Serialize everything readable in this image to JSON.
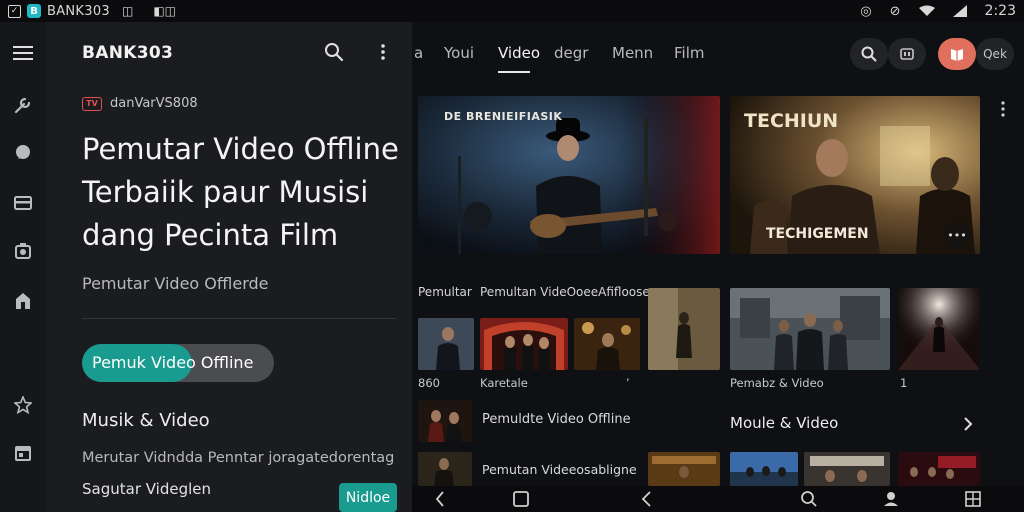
{
  "status_bar": {
    "carrier": "BANK303",
    "time": "2:23"
  },
  "drawer": {
    "app_title": "BANK303",
    "source_label": "danVarVS808",
    "source_logo": "TV",
    "headline": "Pemutar Video Offline Terbaiik paur Musisi dang Pecinta Film",
    "subline": "Pemutar Video Offlerde",
    "pill_label": "Pemuk Video Offline",
    "section_title": "Musik & Video",
    "description_1": "Merutar Vidndda  Penntar joragatedorentag",
    "description_2": "Sagutar Videglen",
    "small_button": "Nidloe"
  },
  "tabs": {
    "items": [
      {
        "label": "a"
      },
      {
        "label": "Youi"
      },
      {
        "label": "Video"
      },
      {
        "label": "degr"
      },
      {
        "label": "Menn"
      },
      {
        "label": "Film"
      }
    ],
    "toolbar_text_button": "Qek"
  },
  "hero": {
    "left_text": "DE  BRENIEIFIASIK",
    "right_title": "TECHIUN",
    "right_caption": "TECHIGEMEN",
    "more_label": "•••"
  },
  "rows": {
    "row1_label_a": "Pemultar",
    "row1_label_b": "Pemultan VideOoeeAfifloose",
    "caption_a": "860",
    "caption_b": "Karetale",
    "caption_c": "’",
    "caption_d": "Pemabz & Video",
    "caption_e": "1",
    "list_item_1": "Pemuldte Video Offline",
    "section_right": "Moule & Video",
    "list_item_2": "Pemutan Videeosabligne"
  },
  "colors": {
    "accent_teal": "#1a9b8f",
    "accent_red": "#e06f5e",
    "background": "#0f1013"
  },
  "icons": [
    "menu-icon",
    "wrench-icon",
    "chat-icon",
    "card-icon",
    "camera-icon",
    "home-icon",
    "star-icon",
    "calendar-icon",
    "search-icon",
    "more-vertical-icon",
    "back-icon",
    "square-icon",
    "chevron-right-icon"
  ]
}
